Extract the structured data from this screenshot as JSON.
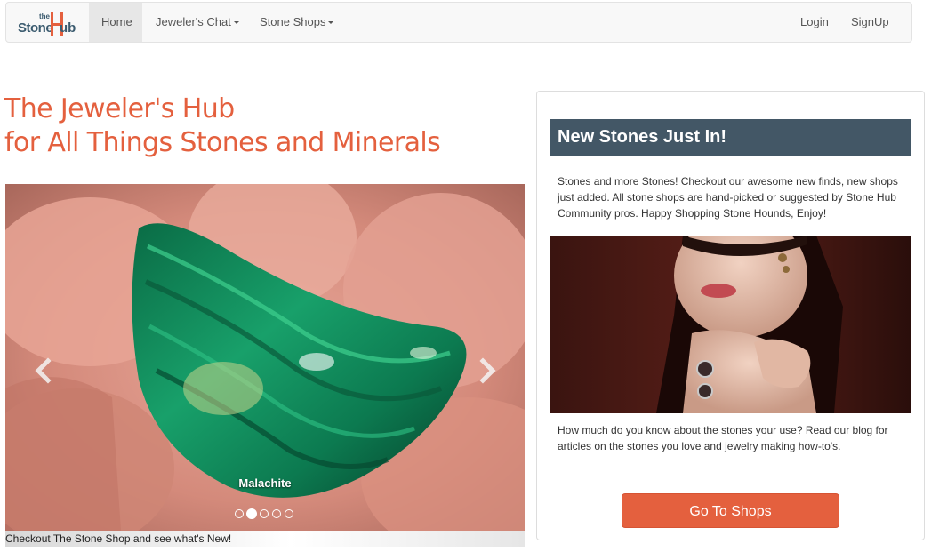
{
  "navbar": {
    "brand": {
      "the": "the",
      "stone": "Stone",
      "hub": "ub"
    },
    "items": [
      {
        "label": "Home",
        "active": true
      },
      {
        "label": "Jeweler's Chat",
        "dropdown": true
      },
      {
        "label": "Stone Shops",
        "dropdown": true
      }
    ],
    "right": [
      {
        "label": "Login"
      },
      {
        "label": "SignUp"
      }
    ]
  },
  "hero": {
    "line1": "The Jeweler's Hub",
    "line2": "for All Things Stones and Minerals"
  },
  "carousel": {
    "caption": "Malachite",
    "indicator_count": 5,
    "active_index": 1,
    "footer_text": "Checkout The Stone Shop and see what's New!"
  },
  "panel": {
    "heading": "New Stones Just In!",
    "intro": "Stones and more Stones! Checkout our awesome new finds, new shops just added. All stone shops are hand-picked or suggested by Stone Hub Community pros. Happy Shopping Stone Hounds, Enjoy!",
    "body": "How much do you know about the stones your use? Read our blog for articles on the stones you love and jewelry making how-to's.",
    "button": "Go To Shops"
  },
  "colors": {
    "accent": "#e4603e",
    "panel_header": "#435766",
    "navbar_bg": "#f8f8f8"
  }
}
